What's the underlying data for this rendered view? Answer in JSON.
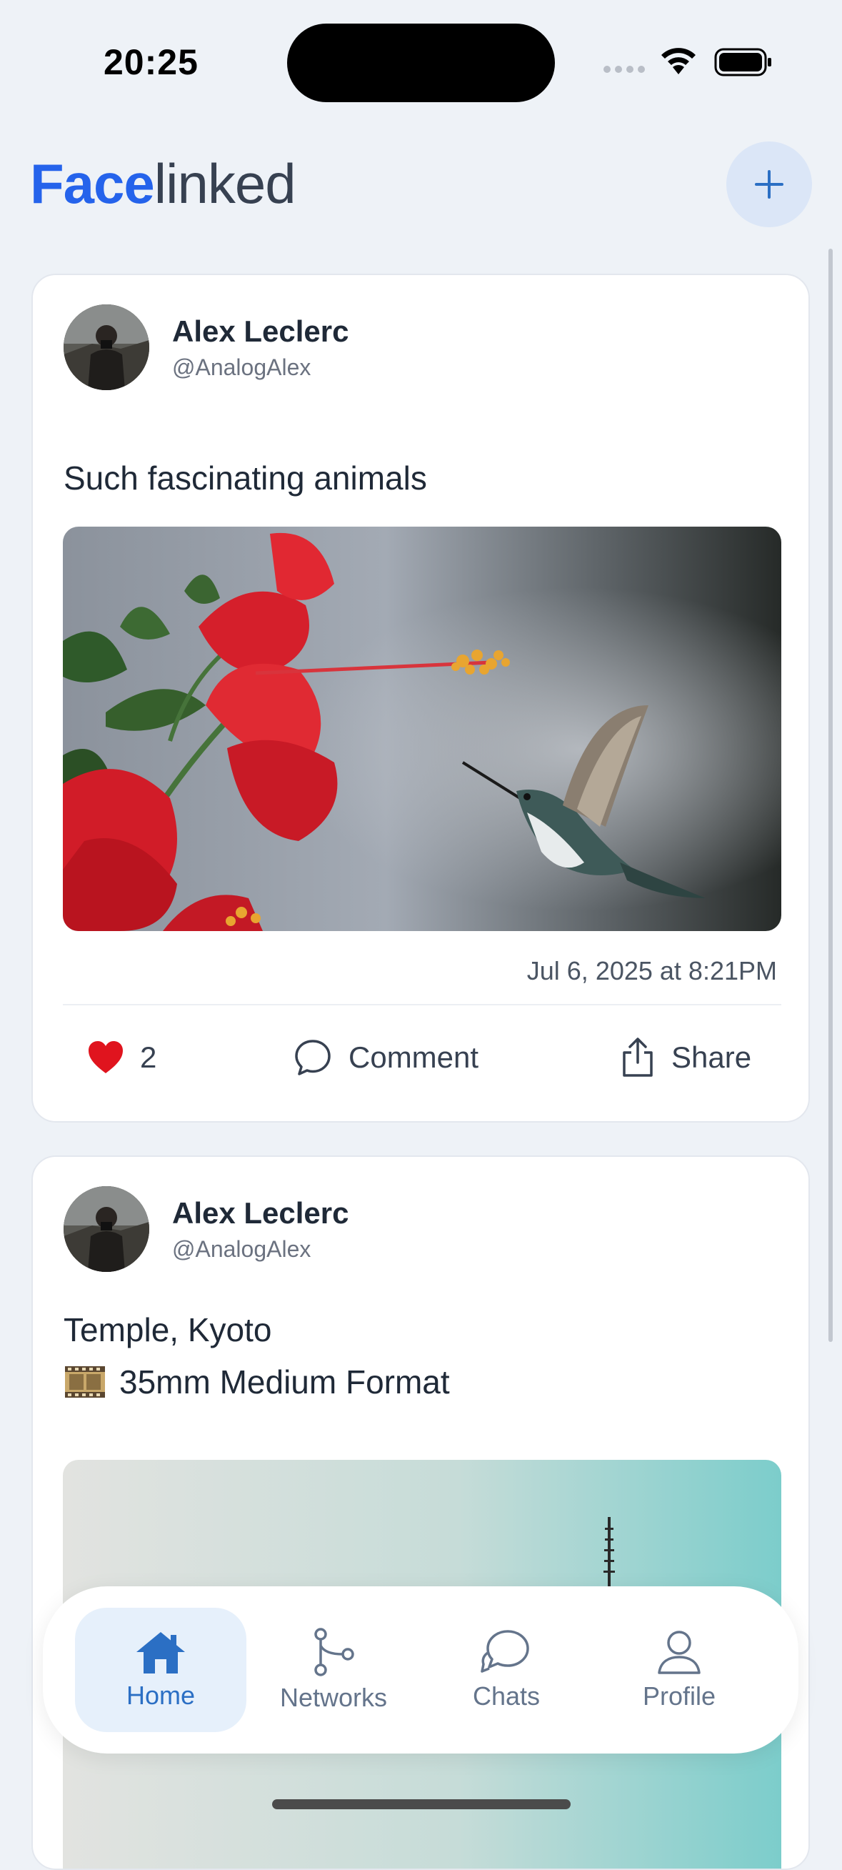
{
  "status_bar": {
    "time": "20:25"
  },
  "header": {
    "title_bold": "Face",
    "title_rest": "linked",
    "add_icon": "plus-icon",
    "accent": "#2563eb"
  },
  "posts": [
    {
      "author": "Alex Leclerc",
      "handle": "@AnalogAlex",
      "text_lines": [
        "Such fascinating animals"
      ],
      "image": "hummingbird-and-red-hibiscus-photo",
      "timestamp": "Jul 6, 2025 at 8:21PM",
      "likes": "2",
      "comment_label": "Comment",
      "share_label": "Share"
    },
    {
      "author": "Alex Leclerc",
      "handle": "@AnalogAlex",
      "text_lines": [
        "Temple, Kyoto",
        "35mm Medium Format"
      ],
      "film_icon": "film-reel-icon",
      "image": "kyoto-temple-sky-photo"
    }
  ],
  "nav": {
    "items": [
      {
        "label": "Home",
        "icon": "home-icon",
        "active": true
      },
      {
        "label": "Networks",
        "icon": "networks-icon",
        "active": false
      },
      {
        "label": "Chats",
        "icon": "chats-icon",
        "active": false
      },
      {
        "label": "Profile",
        "icon": "profile-icon",
        "active": false
      }
    ]
  }
}
